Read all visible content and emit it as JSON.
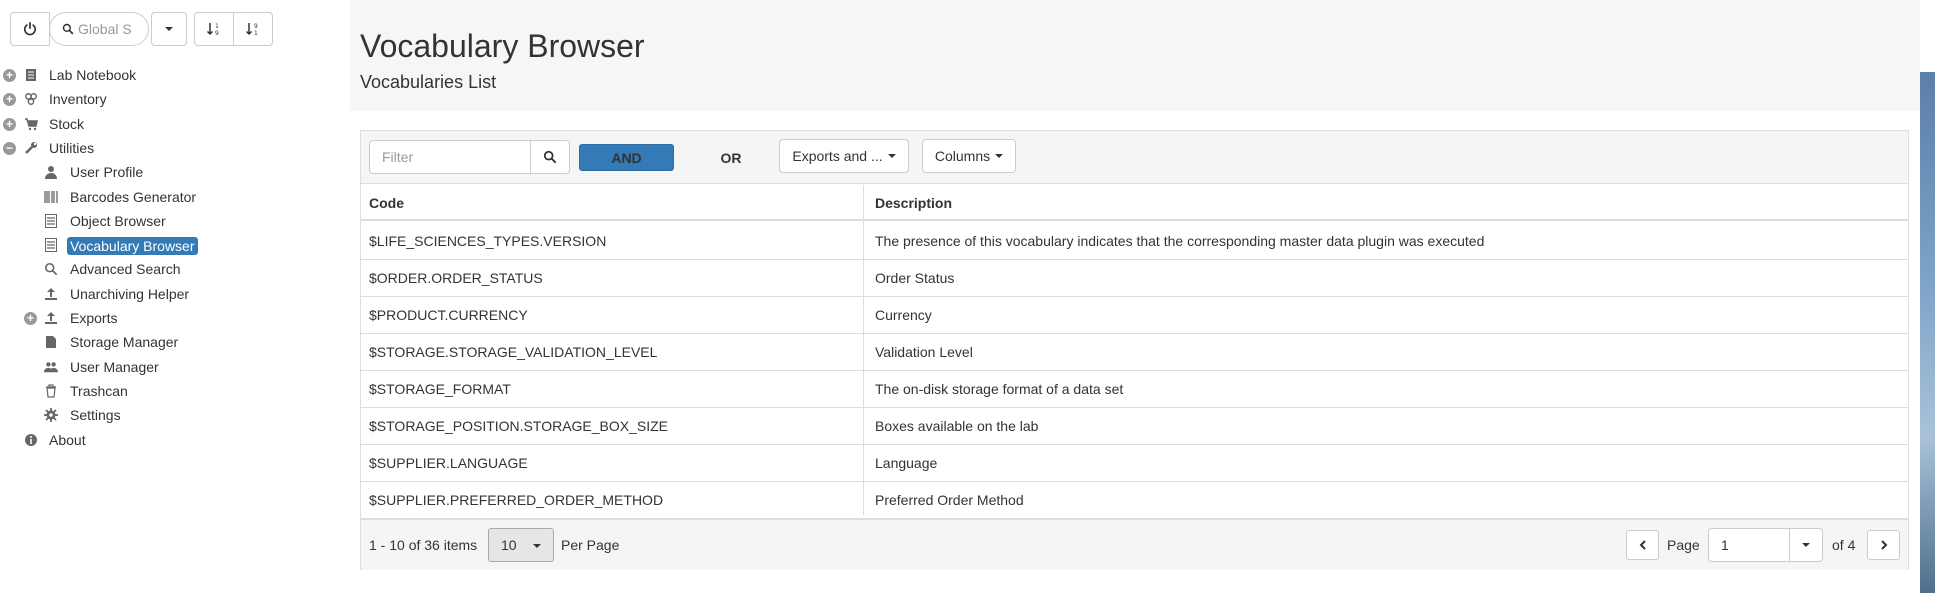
{
  "toolbar": {
    "search_placeholder": "Global S",
    "icons": [
      "power-icon",
      "search-icon",
      "caret-down-icon",
      "sort-asc-icon",
      "sort-desc-icon"
    ]
  },
  "sidebar": {
    "items": [
      {
        "label": "Lab Notebook",
        "icon": "notebook-icon",
        "toggle": "+"
      },
      {
        "label": "Inventory",
        "icon": "inventory-icon",
        "toggle": "+"
      },
      {
        "label": "Stock",
        "icon": "cart-icon",
        "toggle": "+"
      },
      {
        "label": "Utilities",
        "icon": "wrench-icon",
        "toggle": "-"
      },
      {
        "label": "User Profile",
        "icon": "user-icon"
      },
      {
        "label": "Barcodes Generator",
        "icon": "barcode-icon"
      },
      {
        "label": "Object Browser",
        "icon": "list-icon"
      },
      {
        "label": "Vocabulary Browser",
        "icon": "list-icon",
        "selected": true
      },
      {
        "label": "Advanced Search",
        "icon": "search-icon"
      },
      {
        "label": "Unarchiving Helper",
        "icon": "upload-icon"
      },
      {
        "label": "Exports",
        "icon": "export-icon",
        "toggle": "+"
      },
      {
        "label": "Storage Manager",
        "icon": "file-icon"
      },
      {
        "label": "User Manager",
        "icon": "users-icon"
      },
      {
        "label": "Trashcan",
        "icon": "trash-icon"
      },
      {
        "label": "Settings",
        "icon": "gear-icon"
      },
      {
        "label": "About",
        "icon": "info-icon"
      }
    ]
  },
  "header": {
    "title": "Vocabulary Browser",
    "subtitle": "Vocabularies List"
  },
  "grid": {
    "filter_placeholder": "Filter",
    "and_label": "AND",
    "or_label": "OR",
    "exports_label": "Exports and ...",
    "columns_label": "Columns",
    "columns": [
      "Code",
      "Description"
    ],
    "rows": [
      {
        "code": "$LIFE_SCIENCES_TYPES.VERSION",
        "description": "The presence of this vocabulary indicates that the corresponding master data plugin was executed"
      },
      {
        "code": "$ORDER.ORDER_STATUS",
        "description": "Order Status"
      },
      {
        "code": "$PRODUCT.CURRENCY",
        "description": "Currency"
      },
      {
        "code": "$STORAGE.STORAGE_VALIDATION_LEVEL",
        "description": "Validation Level"
      },
      {
        "code": "$STORAGE_FORMAT",
        "description": "The on-disk storage format of a data set"
      },
      {
        "code": "$STORAGE_POSITION.STORAGE_BOX_SIZE",
        "description": "Boxes available on the lab"
      },
      {
        "code": "$SUPPLIER.LANGUAGE",
        "description": "Language"
      },
      {
        "code": "$SUPPLIER.PREFERRED_ORDER_METHOD",
        "description": "Preferred Order Method"
      }
    ],
    "footer": {
      "items_summary": "1 - 10 of 36 items",
      "page_size": "10",
      "per_page_label": "Per Page",
      "page_label": "Page",
      "current_page": "1",
      "of_label": "of 4"
    }
  },
  "colors": {
    "accent": "#337ab7",
    "header_bg": "#f6f6f6",
    "border": "#dddddd"
  }
}
